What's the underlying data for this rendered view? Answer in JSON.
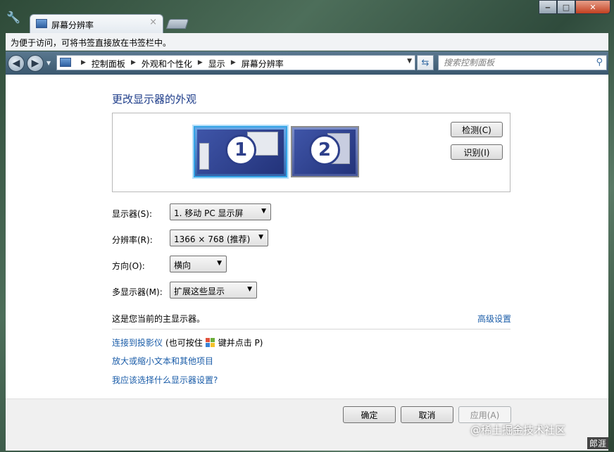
{
  "tab": {
    "title": "屏幕分辨率",
    "close_icon": "×"
  },
  "window_controls": {
    "minimize": "‒",
    "maximize": "□",
    "close": "✕"
  },
  "bookmark_bar": {
    "message": "为便于访问，可将书签直接放在书签栏中。"
  },
  "address_bar": {
    "breadcrumbs": [
      "控制面板",
      "外观和个性化",
      "显示",
      "屏幕分辨率"
    ],
    "search_placeholder": "搜索控制面板"
  },
  "main": {
    "title": "更改显示器的外观",
    "monitors": [
      {
        "number": "1"
      },
      {
        "number": "2"
      }
    ],
    "detect_label": "检测(C)",
    "identify_label": "识别(I)",
    "fields": {
      "display": {
        "label": "显示器(S):",
        "value": "1. 移动 PC 显示屏"
      },
      "resolution": {
        "label": "分辨率(R):",
        "value": "1366 × 768 (推荐)"
      },
      "orientation": {
        "label": "方向(O):",
        "value": "横向"
      },
      "multi_display": {
        "label": "多显示器(M):",
        "value": "扩展这些显示"
      }
    },
    "primary_note": "这是您当前的主显示器。",
    "advanced_link": "高级设置",
    "projector_link": "连接到投影仪",
    "projector_hint_prefix": "(也可按住",
    "projector_hint_suffix": "键并点击 P)",
    "text_size_link": "放大或缩小文本和其他项目",
    "which_settings_link": "我应该选择什么显示器设置?"
  },
  "footer": {
    "ok_label": "确定",
    "cancel_label": "取消",
    "apply_label": "应用(A)"
  },
  "watermark": {
    "text": "@稀土掘金技术社区",
    "corner_text": "郎涯"
  },
  "colors": {
    "link": "#1a5ca8",
    "title": "#1e3d8a",
    "selected_monitor_border": "#35a5e6"
  }
}
